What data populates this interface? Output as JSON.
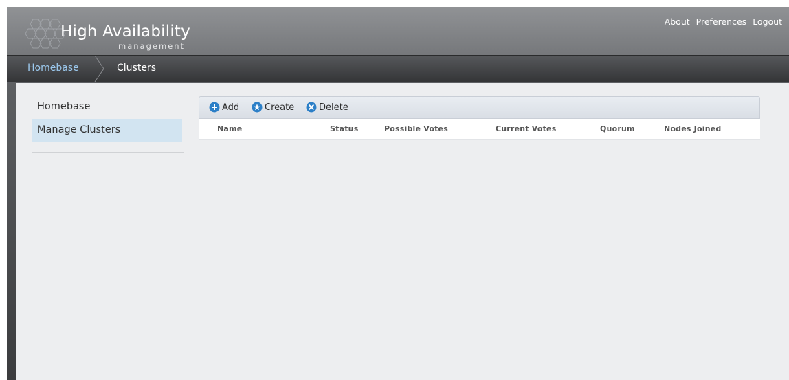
{
  "app": {
    "title": "High Availability",
    "subtitle": "management"
  },
  "topnav": {
    "links": [
      "About",
      "Preferences",
      "Logout"
    ]
  },
  "breadcrumb": {
    "items": [
      "Homebase",
      "Clusters"
    ]
  },
  "sidebar": {
    "items": [
      {
        "label": "Homebase",
        "selected": false
      },
      {
        "label": "Manage Clusters",
        "selected": true
      }
    ]
  },
  "toolbar": {
    "buttons": [
      {
        "label": "Add",
        "icon": "plus-circle-icon"
      },
      {
        "label": "Create",
        "icon": "star-circle-icon"
      },
      {
        "label": "Delete",
        "icon": "x-circle-icon"
      }
    ]
  },
  "table": {
    "columns": [
      "Name",
      "Status",
      "Possible Votes",
      "Current Votes",
      "Quorum",
      "Nodes Joined"
    ],
    "rows": []
  },
  "colors": {
    "accent_blue": "#2c7fc7",
    "breadcrumb_active": "#9cc9ee",
    "sidebar_selected": "#d2e4f1"
  }
}
